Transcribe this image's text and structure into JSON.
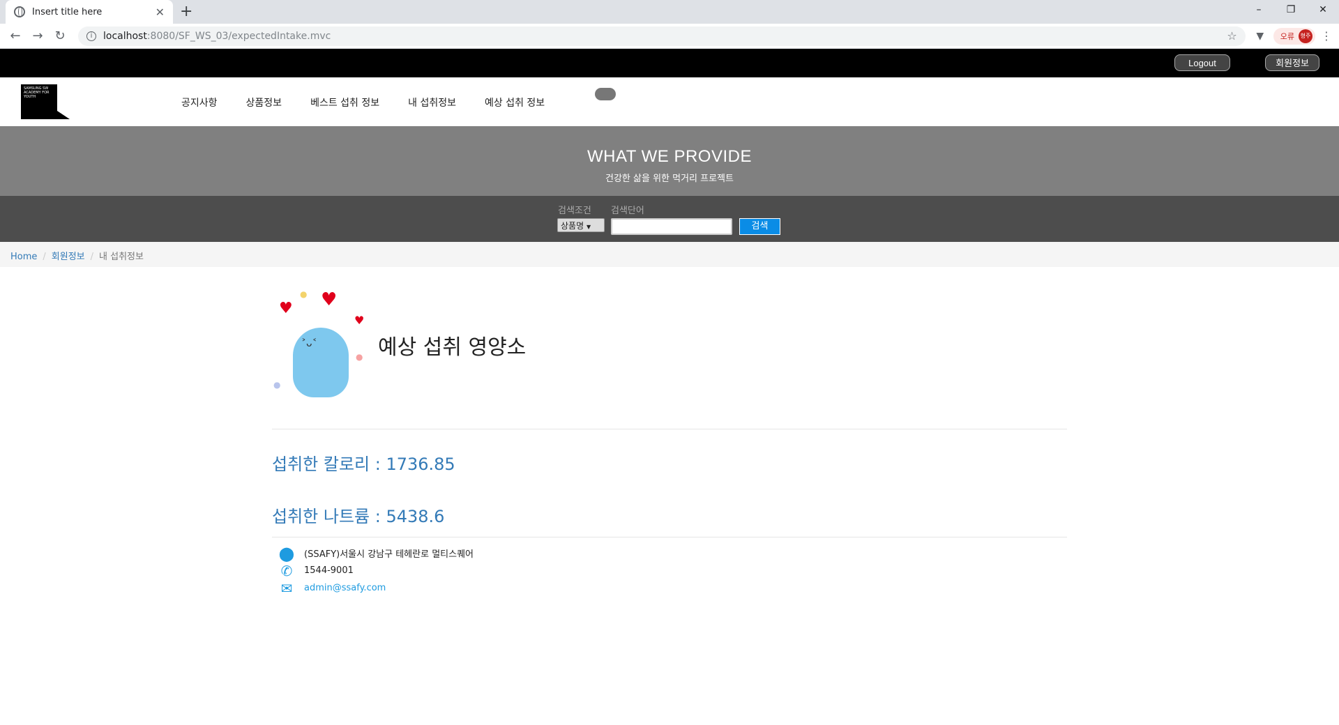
{
  "browser": {
    "tab_title": "Insert title here",
    "url_host": "localhost",
    "url_path": ":8080/SF_WS_03/expectedIntake.mvc",
    "error_label": "오류",
    "avatar_text": "형주"
  },
  "topbar": {
    "logout_label": "Logout",
    "member_label": "회원정보"
  },
  "logo": {
    "text": "SAMSUNG SW ACADEMY FOR YOUTH"
  },
  "nav": {
    "items": [
      "공지사항",
      "상품정보",
      "베스트 섭취 정보",
      "내 섭취정보",
      "예상 섭취 정보"
    ]
  },
  "hero": {
    "title": "WHAT WE PROVIDE",
    "subtitle": "건강한 삶을 위한 먹거리 프로젝트"
  },
  "search": {
    "condition_label": "검색조건",
    "keyword_label": "검색단어",
    "select_value": "상품명",
    "button_label": "검색"
  },
  "breadcrumb": {
    "home": "Home",
    "member": "회원정보",
    "current": "내 섭취정보"
  },
  "main": {
    "heading": "예상 섭취 영양소",
    "calorie": "섭취한 칼로리 : 1736.85",
    "sodium": "섭취한 나트륨 : 5438.6"
  },
  "footer": {
    "address": "(SSAFY)서울시 강남구 테헤란로 멀티스퀘어",
    "phone": "1544-9001",
    "email": "admin@ssafy.com"
  },
  "colors": {
    "accent": "#337ab7",
    "search_button": "#0a8ce6",
    "hero_bg": "#808080",
    "search_bg": "#4d4d4d"
  }
}
